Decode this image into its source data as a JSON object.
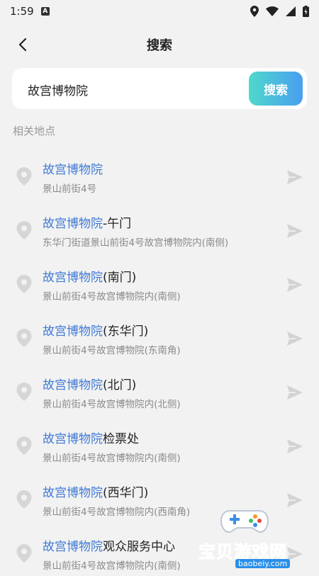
{
  "status_bar": {
    "time": "1:59",
    "a_badge": "A"
  },
  "header": {
    "title": "搜索"
  },
  "search": {
    "value": "故宫博物院",
    "button_label": "搜索"
  },
  "section_title": "相关地点",
  "results": [
    {
      "highlight": "故宫博物院",
      "suffix": "",
      "address": "景山前街4号"
    },
    {
      "highlight": "故宫博物院",
      "suffix": "-午门",
      "address": "东华门街道景山前街4号故宫博物院内(南侧)"
    },
    {
      "highlight": "故宫博物院",
      "suffix": "(南门)",
      "address": "景山前街4号故宫博物院内(南侧)"
    },
    {
      "highlight": "故宫博物院",
      "suffix": "(东华门)",
      "address": "景山前街4号故宫博物院(东南角)"
    },
    {
      "highlight": "故宫博物院",
      "suffix": "(北门)",
      "address": "景山前街4号故宫博物院内(北侧)"
    },
    {
      "highlight": "故宫博物院",
      "suffix": "检票处",
      "address": "景山前街4号故宫博物院内(南侧)"
    },
    {
      "highlight": "故宫博物院",
      "suffix": "(西华门)",
      "address": "景山前街4号故宫博物院内(西南角)"
    },
    {
      "highlight": "故宫博物院",
      "suffix": "观众服务中心",
      "address": "景山前街4号故宫博物院内(南侧)"
    }
  ],
  "watermark": {
    "text": "宝贝游戏网",
    "url": "baobeiy.com"
  },
  "colors": {
    "highlight": "#3f7ad6",
    "button_gradient_start": "#4ed8cc",
    "button_gradient_end": "#4a9ff0"
  }
}
